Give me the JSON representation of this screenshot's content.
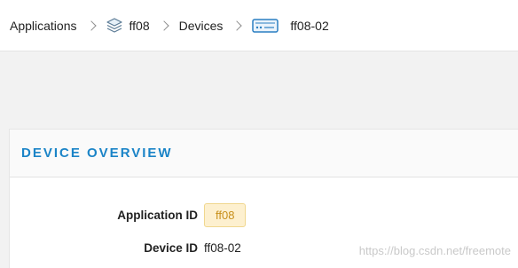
{
  "breadcrumb": {
    "applications": "Applications",
    "app": "ff08",
    "devices": "Devices",
    "device": "ff08-02"
  },
  "overview": {
    "title": "DEVICE OVERVIEW",
    "application_id_label": "Application ID",
    "application_id_value": "ff08",
    "device_id_label": "Device ID",
    "device_id_value": "ff08-02"
  },
  "watermark": "https://blog.csdn.net/freemote",
  "colors": {
    "accent": "#1b84c7",
    "badge_bg": "#fdf0cf",
    "badge_text": "#c8901c"
  }
}
